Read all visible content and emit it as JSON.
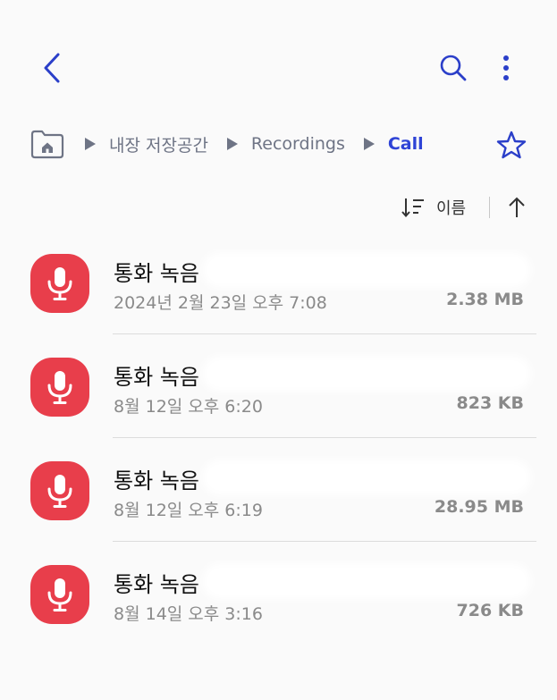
{
  "toolbar": {
    "back_icon": "chevron-left-icon",
    "search_icon": "search-icon",
    "more_icon": "more-vertical-icon"
  },
  "breadcrumb": {
    "home_icon": "home-folder-icon",
    "items": [
      "내장 저장공간",
      "Recordings",
      "Call"
    ],
    "favorite_icon": "star-icon"
  },
  "sort": {
    "label": "이름",
    "order_icon": "arrow-up-icon"
  },
  "files": [
    {
      "title": "통화 녹음",
      "date": "2024년 2월 23일 오후 7:08",
      "size": "2.38 MB"
    },
    {
      "title": "통화 녹음",
      "date": "8월 12일 오후 6:20",
      "size": "823 KB"
    },
    {
      "title": "통화 녹음",
      "date": "8월 12일 오후 6:19",
      "size": "28.95 MB"
    },
    {
      "title": "통화 녹음",
      "date": "8월 14일 오후 3:16",
      "size": "726 KB"
    }
  ],
  "colors": {
    "accent": "#2e43d6",
    "icon_bg": "#e83e4b",
    "muted": "#8a8a8a"
  }
}
